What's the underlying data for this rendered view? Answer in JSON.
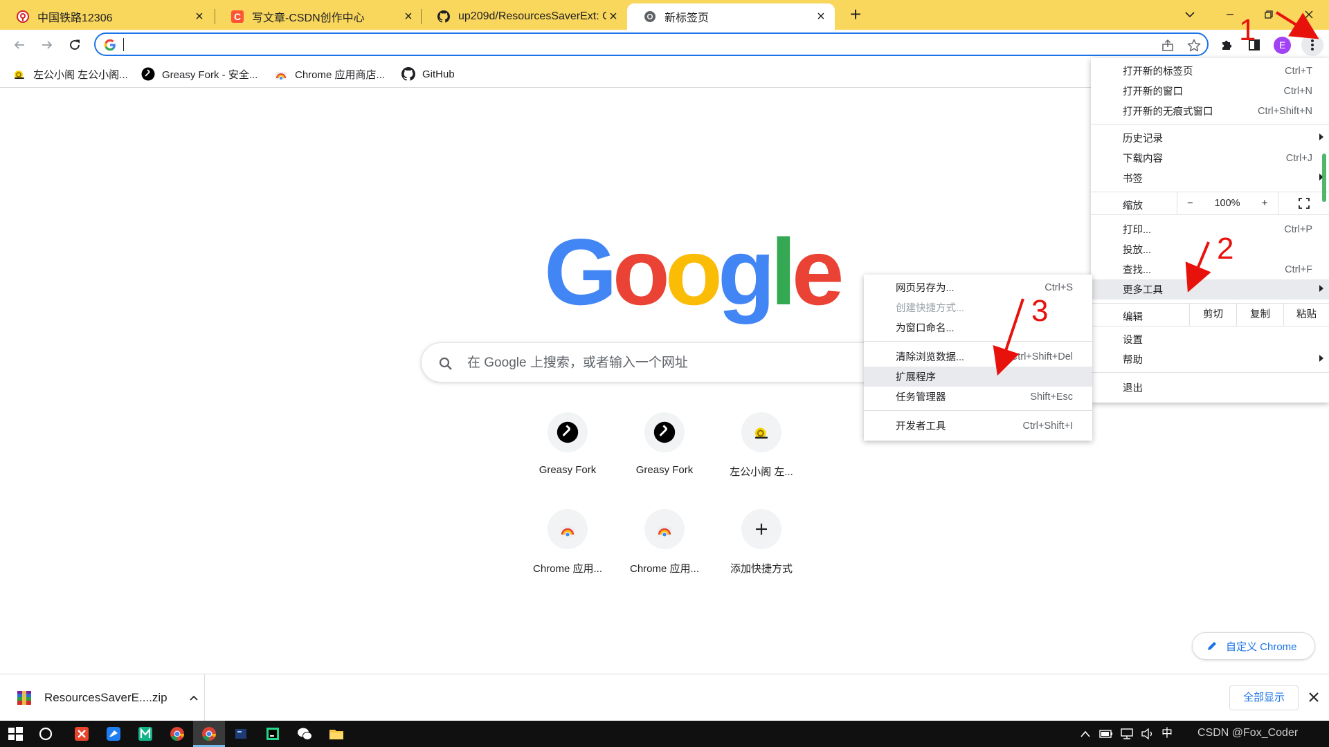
{
  "tabs": [
    {
      "title": "中国铁路12306",
      "icon": "railway-favicon",
      "active": false
    },
    {
      "title": "写文章-CSDN创作中心",
      "icon": "csdn-favicon",
      "active": false
    },
    {
      "title": "up209d/ResourcesSaverExt: Ch",
      "icon": "github-favicon",
      "active": false
    },
    {
      "title": "新标签页",
      "icon": "chrome-favicon",
      "active": true
    }
  ],
  "toolbar": {
    "omnibox_value": "",
    "avatar_letter": "E"
  },
  "bookmarks": [
    {
      "label": "左公小阁 左公小阁...",
      "icon": "snail-icon"
    },
    {
      "label": "Greasy Fork - 安全...",
      "icon": "greasyfork-icon"
    },
    {
      "label": "Chrome 应用商店...",
      "icon": "chrome-webstore-icon"
    },
    {
      "label": "GitHub",
      "icon": "github-icon"
    }
  ],
  "search": {
    "placeholder": "在 Google 上搜索，或者输入一个网址"
  },
  "logo": {
    "letters": [
      "G",
      "o",
      "o",
      "g",
      "l",
      "e"
    ],
    "colors": [
      "#4285f4",
      "#ea4335",
      "#fbbc05",
      "#4285f4",
      "#34a853",
      "#ea4335"
    ]
  },
  "shortcuts": [
    {
      "label": "Greasy Fork",
      "icon": "greasyfork-icon"
    },
    {
      "label": "Greasy Fork",
      "icon": "greasyfork-icon"
    },
    {
      "label": "左公小阁 左...",
      "icon": "snail-icon"
    },
    {
      "label": "Chrome 应用...",
      "icon": "chrome-webstore-icon"
    },
    {
      "label": "Chrome 应用...",
      "icon": "chrome-webstore-icon"
    },
    {
      "label": "添加快捷方式",
      "icon": "plus-icon"
    }
  ],
  "customize": {
    "label": "自定义 Chrome"
  },
  "download": {
    "filename": "ResourcesSaverE....zip",
    "show_all": "全部显示"
  },
  "main_menu": {
    "new_tab": {
      "label": "打开新的标签页",
      "shortcut": "Ctrl+T"
    },
    "new_window": {
      "label": "打开新的窗口",
      "shortcut": "Ctrl+N"
    },
    "incognito": {
      "label": "打开新的无痕式窗口",
      "shortcut": "Ctrl+Shift+N"
    },
    "history": {
      "label": "历史记录"
    },
    "downloads": {
      "label": "下载内容",
      "shortcut": "Ctrl+J"
    },
    "bookmarks": {
      "label": "书签"
    },
    "zoom": {
      "label": "缩放",
      "minus": "−",
      "value": "100%",
      "plus": "+"
    },
    "print": {
      "label": "打印...",
      "shortcut": "Ctrl+P"
    },
    "cast": {
      "label": "投放..."
    },
    "find": {
      "label": "查找...",
      "shortcut": "Ctrl+F"
    },
    "more_tools": {
      "label": "更多工具"
    },
    "edit": {
      "label": "编辑",
      "cut": "剪切",
      "copy": "复制",
      "paste": "粘贴"
    },
    "settings": {
      "label": "设置"
    },
    "help": {
      "label": "帮助"
    },
    "exit": {
      "label": "退出"
    }
  },
  "more_tools_menu": {
    "save_page": {
      "label": "网页另存为...",
      "shortcut": "Ctrl+S"
    },
    "create_shortcut": {
      "label": "创建快捷方式..."
    },
    "name_window": {
      "label": "为窗口命名..."
    },
    "clear_data": {
      "label": "清除浏览数据...",
      "shortcut": "Ctrl+Shift+Del"
    },
    "extensions": {
      "label": "扩展程序"
    },
    "task_manager": {
      "label": "任务管理器",
      "shortcut": "Shift+Esc"
    },
    "dev_tools": {
      "label": "开发者工具",
      "shortcut": "Ctrl+Shift+I"
    }
  },
  "annotations": [
    "1",
    "2",
    "3"
  ],
  "taskbar": {
    "ime": "中",
    "clock": "CSDN @Fox_Coder"
  },
  "colors": {
    "tabstrip": "#f9d65c",
    "accent": "#1a73e8",
    "annotation": "#e8120c"
  }
}
